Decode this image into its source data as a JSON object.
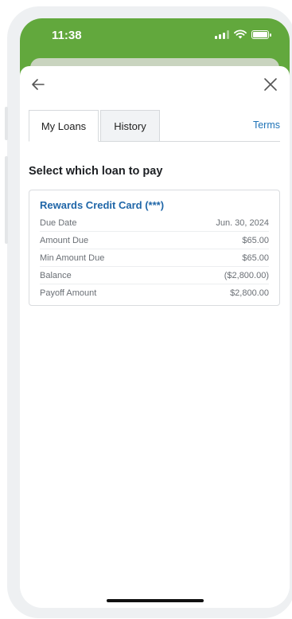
{
  "status_bar": {
    "time": "11:38",
    "icons": [
      "signal-icon",
      "wifi-icon",
      "battery-icon"
    ]
  },
  "nav": {
    "back_icon": "arrow-left-icon",
    "close_icon": "close-icon"
  },
  "tabs": [
    {
      "label": "My Loans",
      "active": true
    },
    {
      "label": "History",
      "active": false
    }
  ],
  "terms_label": "Terms",
  "section_title": "Select which loan to pay",
  "loan": {
    "name": "Rewards Credit Card (***)",
    "rows": [
      {
        "label": "Due Date",
        "value": "Jun. 30, 2024"
      },
      {
        "label": "Amount Due",
        "value": "$65.00"
      },
      {
        "label": "Min Amount Due",
        "value": "$65.00"
      },
      {
        "label": "Balance",
        "value": "($2,800.00)"
      },
      {
        "label": "Payoff Amount",
        "value": "$2,800.00"
      }
    ]
  },
  "colors": {
    "header_green": "#62a83d",
    "link_blue": "#1f73b7",
    "loan_title_blue": "#1f66a8"
  }
}
